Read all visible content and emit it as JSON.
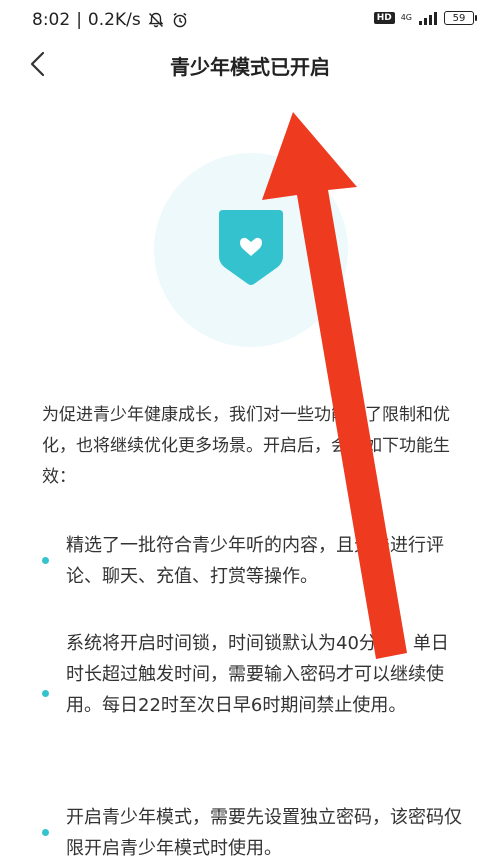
{
  "status_bar": {
    "time": "8:02",
    "network_speed": "0.2K/s",
    "hd_label": "HD",
    "network_type": "4G",
    "battery": "59"
  },
  "header": {
    "title": "青少年模式已开启"
  },
  "content": {
    "intro": "为促进青少年健康成长，我们对一些功能做了限制和优化，也将继续优化更多场景。开启后，会有如下功能生效：",
    "features": [
      "精选了一批符合青少年听的内容，且无法进行评论、聊天、充值、打赏等操作。",
      "系统将开启时间锁，时间锁默认为40分钟。单日时长超过触发时间，需要输入密码才可以继续使用。每日22时至次日早6时期间禁止使用。",
      "开启青少年模式，需要先设置独立密码，该密码仅限开启青少年模式时使用。"
    ]
  },
  "colors": {
    "accent": "#34c2cf",
    "hero_bg": "#eef9fb",
    "annotation_arrow": "#ee3a1f"
  },
  "icons": {
    "back": "chevron-left-icon",
    "shield": "shield-heart-icon",
    "mute": "bell-off-icon",
    "alarm": "alarm-icon"
  }
}
